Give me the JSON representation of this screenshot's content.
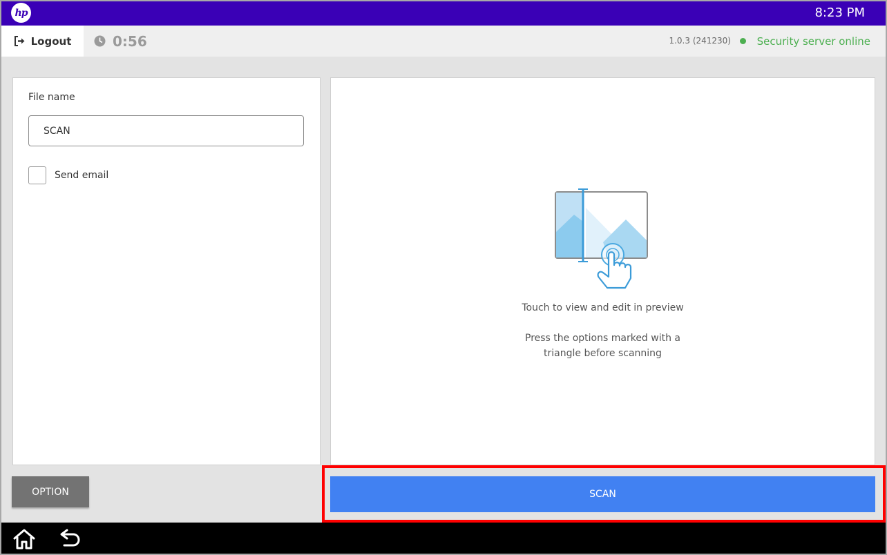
{
  "topbar": {
    "logo_text": "hp",
    "time": "8:23 PM",
    "colors": {
      "background": "#3a00b6"
    }
  },
  "session": {
    "logout_label": "Logout",
    "logout_icon": "logout-icon",
    "timer": "0:56",
    "timer_icon": "clock-icon",
    "version": "1.0.3 (241230)",
    "status_text": "Security server online",
    "status_color": "#4caf50"
  },
  "form": {
    "file_name_label": "File name",
    "file_name_value": "SCAN",
    "send_email_label": "Send email",
    "send_email_checked": false
  },
  "preview": {
    "icon": "touch-preview-icon",
    "touch_text": "Touch to view and edit in preview",
    "options_line1": "Press the options marked with a",
    "options_line2": "triangle before scanning"
  },
  "actions": {
    "option_label": "OPTION",
    "scan_label": "SCAN",
    "scan_color": "#4181f2",
    "highlight_color": "#ff0000"
  },
  "nav": {
    "home_icon": "home-icon",
    "back_icon": "back-icon"
  }
}
